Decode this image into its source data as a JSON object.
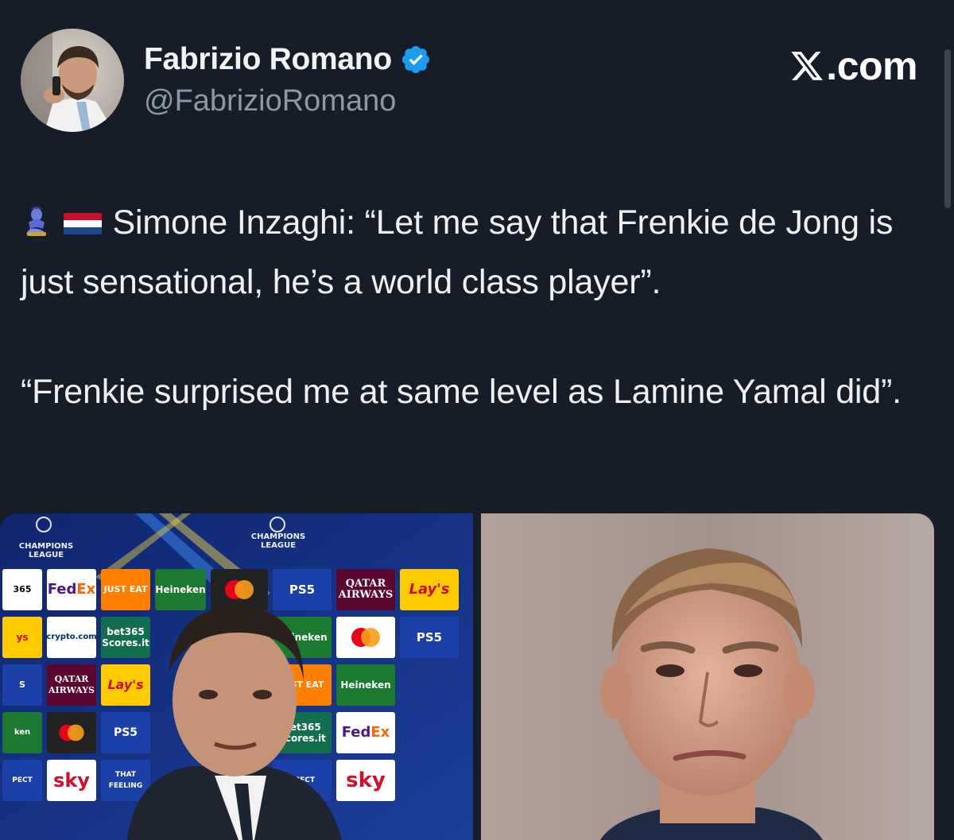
{
  "author": {
    "display_name": "Fabrizio Romano",
    "handle": "@FabrizioRomano",
    "verified": true
  },
  "brand": {
    "logo_letter": "X",
    "suffix": ".com"
  },
  "tweet": {
    "lead_icons": [
      "genie-emoji",
      "netherlands-flag-emoji"
    ],
    "paragraph_1": "Simone Inzaghi: “Let me say that Frenkie de Jong is just sensational, he’s a world class player”.",
    "paragraph_2": "“Frenkie surprised me at same level as Lamine Yamal did”."
  },
  "media": {
    "left_image": {
      "description_icon": "press-conference-photo",
      "backdrop_text": {
        "ucl_1": "CHAMPIONS LEAGUE",
        "ucl_2": "CHAMPIONS LEAGUE",
        "sponsors": [
          "FedEx",
          "JUST EAT",
          "Heineken",
          "PS5",
          "QATAR AIRWAYS",
          "Lay's",
          "bet365 Scores.it",
          "crypto.com",
          "sky"
        ]
      }
    },
    "right_image": {
      "description_icon": "player-portrait-photo"
    }
  },
  "colors": {
    "background": "#161d29",
    "text_primary": "#eef0f2",
    "text_secondary": "#8b98a5",
    "verified_blue": "#1d9bf0"
  }
}
